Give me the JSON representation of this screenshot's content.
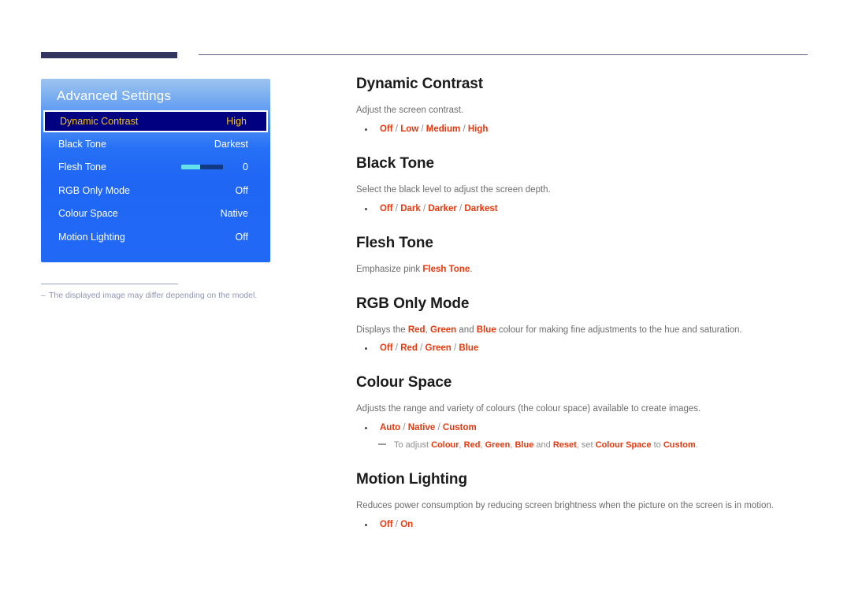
{
  "header": {
    "bar_label": "section-bar",
    "rule_label": "header-rule"
  },
  "osd": {
    "title": "Advanced Settings",
    "rows": [
      {
        "label": "Dynamic Contrast",
        "value": "High",
        "selected": true,
        "type": "value"
      },
      {
        "label": "Black Tone",
        "value": "Darkest",
        "selected": false,
        "type": "value"
      },
      {
        "label": "Flesh Tone",
        "value": "0",
        "selected": false,
        "type": "slider",
        "fill_percent": 45
      },
      {
        "label": "RGB Only Mode",
        "value": "Off",
        "selected": false,
        "type": "value"
      },
      {
        "label": "Colour Space",
        "value": "Native",
        "selected": false,
        "type": "value"
      },
      {
        "label": "Motion Lighting",
        "value": "Off",
        "selected": false,
        "type": "value"
      }
    ],
    "footnote_dash": "‒",
    "footnote": "The displayed image may differ depending on the model."
  },
  "sections": [
    {
      "heading": "Dynamic Contrast",
      "description": "Adjust the screen contrast.",
      "options": [
        "Off",
        "Low",
        "Medium",
        "High"
      ]
    },
    {
      "heading": "Black Tone",
      "description": "Select the black level to adjust the screen depth.",
      "options": [
        "Off",
        "Dark",
        "Darker",
        "Darkest"
      ]
    },
    {
      "heading": "Flesh Tone",
      "description_parts": [
        {
          "text": "Emphasize pink ",
          "em": false
        },
        {
          "text": "Flesh Tone",
          "em": true
        },
        {
          "text": ".",
          "em": false
        }
      ],
      "options": []
    },
    {
      "heading": "RGB Only Mode",
      "description_parts": [
        {
          "text": "Displays the ",
          "em": false
        },
        {
          "text": "Red",
          "em": true
        },
        {
          "text": ", ",
          "em": false
        },
        {
          "text": "Green",
          "em": true
        },
        {
          "text": " and ",
          "em": false
        },
        {
          "text": "Blue",
          "em": true
        },
        {
          "text": " colour for making fine adjustments to the hue and saturation.",
          "em": false
        }
      ],
      "options": [
        "Off",
        "Red",
        "Green",
        "Blue"
      ]
    },
    {
      "heading": "Colour Space",
      "description": "Adjusts the range and variety of colours (the colour space) available to create images.",
      "options": [
        "Auto",
        "Native",
        "Custom"
      ],
      "note_parts": [
        {
          "text": "To adjust ",
          "em": false
        },
        {
          "text": "Colour",
          "em": true
        },
        {
          "text": ", ",
          "em": false
        },
        {
          "text": "Red",
          "em": true
        },
        {
          "text": ", ",
          "em": false
        },
        {
          "text": "Green",
          "em": true
        },
        {
          "text": ", ",
          "em": false
        },
        {
          "text": "Blue",
          "em": true
        },
        {
          "text": " and ",
          "em": false
        },
        {
          "text": "Reset",
          "em": true
        },
        {
          "text": ", set ",
          "em": false
        },
        {
          "text": "Colour Space",
          "em": true
        },
        {
          "text": " to ",
          "em": false
        },
        {
          "text": "Custom",
          "em": true
        },
        {
          "text": ".",
          "em": false
        }
      ]
    },
    {
      "heading": "Motion Lighting",
      "description": "Reduces power consumption by reducing screen brightness when the picture on the screen is in motion.",
      "options": [
        "Off",
        "On"
      ]
    }
  ],
  "colors": {
    "osd_blue": "#1f66f5",
    "osd_selected_bg": "#000080",
    "osd_selected_text": "#f6c518",
    "slider_fill": "#63e0e8",
    "accent_red": "#e8380d",
    "header_navy": "#33355e",
    "body_gray": "#6d6d6d"
  }
}
